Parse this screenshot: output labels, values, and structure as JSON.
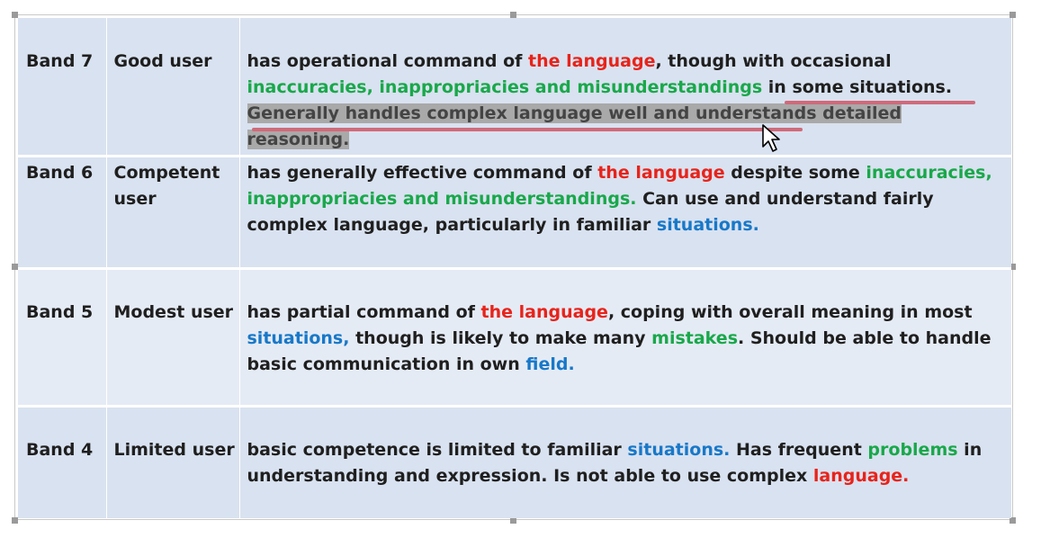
{
  "table": {
    "rows": [
      {
        "band": "Band 7",
        "user": "Good user",
        "desc": [
          {
            "t": "has operational command of ",
            "c": ""
          },
          {
            "t": "the language",
            "c": "red"
          },
          {
            "t": ", though with occasional ",
            "c": ""
          },
          {
            "t": "inaccuracies, inappropriacies and misunderstandings",
            "c": "green"
          },
          {
            "t": " in some situations. ",
            "c": ""
          },
          {
            "t": "Generally handles complex language well and understands detailed reasoning.",
            "c": "sel"
          }
        ]
      },
      {
        "band": "Band 6",
        "user": "Competent user",
        "desc": [
          {
            "t": "has generally effective command of ",
            "c": ""
          },
          {
            "t": "the language",
            "c": "red"
          },
          {
            "t": " despite some ",
            "c": ""
          },
          {
            "t": "inaccuracies, inappropriacies and misunderstandings.",
            "c": "green"
          },
          {
            "t": " Can use and understand fairly complex language, particularly in familiar ",
            "c": ""
          },
          {
            "t": "situations.",
            "c": "blue"
          }
        ]
      },
      {
        "band": "Band 5",
        "user": "Modest user",
        "desc": [
          {
            "t": "has partial command of ",
            "c": ""
          },
          {
            "t": "the language",
            "c": "red"
          },
          {
            "t": ", coping with overall meaning in most ",
            "c": ""
          },
          {
            "t": "situations,",
            "c": "blue"
          },
          {
            "t": " though is likely to make many ",
            "c": ""
          },
          {
            "t": "mistakes",
            "c": "green"
          },
          {
            "t": ". Should be able to handle basic communication in own ",
            "c": ""
          },
          {
            "t": "field.",
            "c": "blue"
          }
        ]
      },
      {
        "band": "Band 4",
        "user": "Limited user",
        "desc": [
          {
            "t": "basic competence is limited to familiar ",
            "c": ""
          },
          {
            "t": "situations.",
            "c": "blue"
          },
          {
            "t": " Has frequent ",
            "c": ""
          },
          {
            "t": "problems",
            "c": "green"
          },
          {
            "t": " in understanding and expression. Is not able to use complex ",
            "c": ""
          },
          {
            "t": "language.",
            "c": "red"
          }
        ]
      }
    ]
  },
  "colors": {
    "red": "#e8231a",
    "green": "#19a84a",
    "blue": "#1878c8",
    "selection": "#a9a9a9",
    "row_bg": "#d9e2f0",
    "underline": "#d06a7a"
  },
  "icons": {
    "cursor": "mouse-pointer-icon"
  }
}
